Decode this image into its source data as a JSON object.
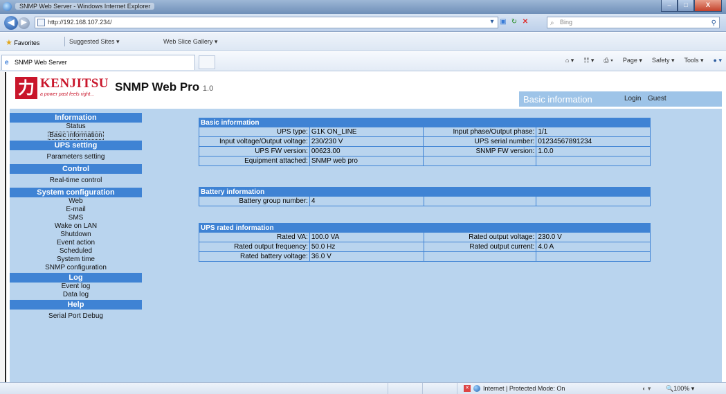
{
  "window": {
    "title": "SNMP Web Server - Windows Internet Explorer",
    "min_label": "–",
    "max_label": "□",
    "close_label": "X"
  },
  "browser": {
    "url": "http://192.168.107.234/",
    "search_placeholder": "Bing",
    "favorites_label": "Favorites",
    "suggested_sites_label": "Suggested Sites ▾",
    "web_slice_gallery_label": "Web Slice Gallery ▾",
    "tab_title": "SNMP Web Server",
    "commands": [
      "Page ▾",
      "Safety ▾",
      "Tools ▾"
    ]
  },
  "header": {
    "logo_char": "力",
    "logo_text": "KENJITSU",
    "tagline": "a power past feels right...",
    "product": "SNMP Web Pro",
    "version": "1.0",
    "section": "Basic information",
    "login_label": "Login",
    "user": "Guest"
  },
  "sidebar": {
    "sections": [
      {
        "title": "Information",
        "items": [
          "Status",
          "Basic information"
        ]
      },
      {
        "title": "UPS setting",
        "items": [
          "Parameters setting"
        ]
      },
      {
        "title": "Control",
        "items": [
          "Real-time control"
        ]
      },
      {
        "title": "System configuration",
        "items": [
          "Web",
          "E-mail",
          "SMS",
          "Wake on LAN",
          "Shutdown",
          "Event action",
          "Scheduled",
          "System time",
          "SNMP configuration"
        ]
      },
      {
        "title": "Log",
        "items": [
          "Event log",
          "Data log"
        ]
      },
      {
        "title": "Help",
        "items": [
          "Serial Port Debug"
        ]
      }
    ]
  },
  "basic": {
    "title": "Basic information",
    "rows": [
      [
        "UPS type:",
        "G1K ON_LINE",
        "Input phase/Output phase:",
        "1/1"
      ],
      [
        "Input voltage/Output voltage:",
        "230/230 V",
        "UPS serial number:",
        "01234567891234"
      ],
      [
        "UPS FW version:",
        "00623.00",
        "SNMP FW version:",
        "1.0.0"
      ],
      [
        "Equipment attached:",
        "SNMP web pro",
        "",
        ""
      ]
    ]
  },
  "battery": {
    "title": "Battery information",
    "rows": [
      [
        "Battery group number:",
        "4",
        "",
        ""
      ]
    ]
  },
  "rated": {
    "title": "UPS rated information",
    "rows": [
      [
        "Rated VA:",
        "100.0 VA",
        "Rated output voltage:",
        "230.0 V"
      ],
      [
        "Rated output frequency:",
        "50.0 Hz",
        "Rated output current:",
        "4.0 A"
      ],
      [
        "Rated battery voltage:",
        "36.0 V",
        "",
        ""
      ]
    ]
  },
  "status": {
    "zone": "Internet | Protected Mode: On",
    "zoom": "100%"
  }
}
